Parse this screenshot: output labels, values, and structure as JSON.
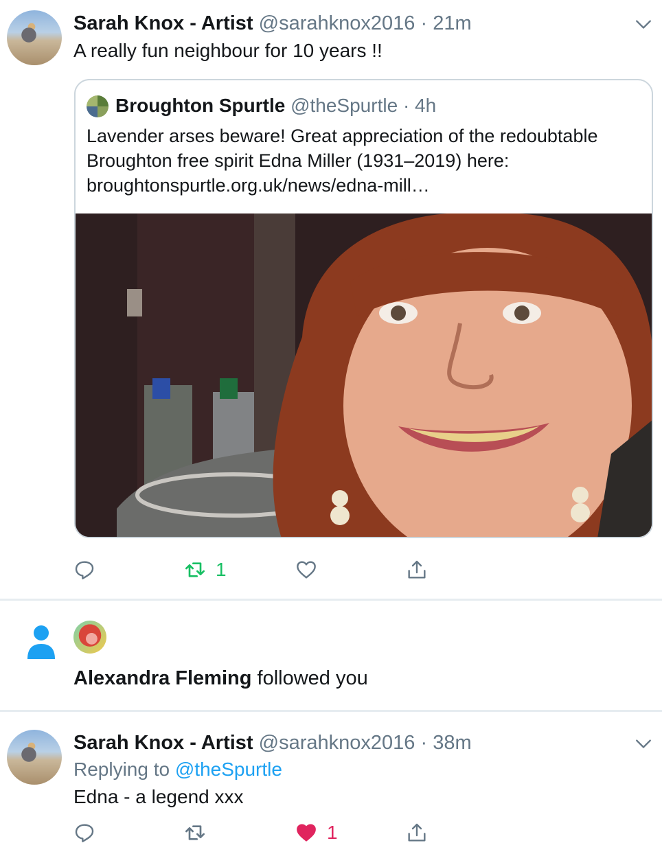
{
  "tweet1": {
    "name": "Sarah Knox - Artist",
    "handle": "@sarahknox2016",
    "sep": "·",
    "time": "21m",
    "text": "A really fun neighbour for 10 years !!",
    "quote": {
      "name": "Broughton Spurtle",
      "handle": "@theSpurtle",
      "sep": "·",
      "time": "4h",
      "text": "Lavender arses beware! Great appreciation of the redoubtable Broughton free spirit Edna Miller (1931–2019) here: broughtonspurtle.org.uk/news/edna-mill…"
    },
    "actions": {
      "retweet_count": "1",
      "like_count": ""
    }
  },
  "follow": {
    "name": "Alexandra Fleming",
    "text": "followed you"
  },
  "tweet2": {
    "name": "Sarah Knox - Artist",
    "handle": "@sarahknox2016",
    "sep": "·",
    "time": "38m",
    "replying_prefix": "Replying to",
    "replying_to": "@theSpurtle",
    "text": "Edna - a legend xxx",
    "actions": {
      "retweet_count": "",
      "like_count": "1"
    }
  },
  "colors": {
    "retweet_active": "#17bf63",
    "like_active": "#e0245e",
    "link": "#1da1f2",
    "muted": "#657786"
  }
}
